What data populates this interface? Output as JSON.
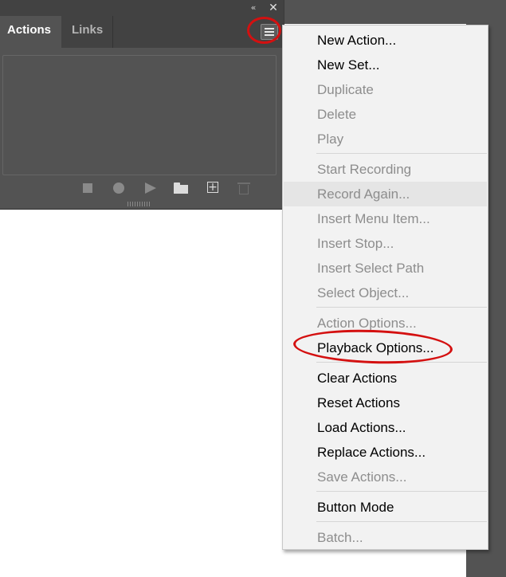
{
  "panel": {
    "collapse_glyph": "«",
    "close_glyph": "✕",
    "tabs": [
      {
        "label": "Actions",
        "active": true
      },
      {
        "label": "Links",
        "active": false
      }
    ],
    "toolbar_icons": [
      "stop-icon",
      "record-icon",
      "play-icon",
      "folder-icon",
      "new-action-icon",
      "trash-icon"
    ]
  },
  "menu": {
    "items": [
      {
        "label": "New Action...",
        "enabled": true
      },
      {
        "label": "New Set...",
        "enabled": true
      },
      {
        "label": "Duplicate",
        "enabled": false
      },
      {
        "label": "Delete",
        "enabled": false
      },
      {
        "label": "Play",
        "enabled": false
      },
      {
        "label": "Start Recording",
        "enabled": false
      },
      {
        "label": "Record Again...",
        "enabled": false,
        "highlighted": true
      },
      {
        "label": "Insert Menu Item...",
        "enabled": false
      },
      {
        "label": "Insert Stop...",
        "enabled": false
      },
      {
        "label": "Insert Select Path",
        "enabled": false
      },
      {
        "label": "Select Object...",
        "enabled": false
      },
      {
        "label": "Action Options...",
        "enabled": false
      },
      {
        "label": "Playback Options...",
        "enabled": true
      },
      {
        "label": "Clear Actions",
        "enabled": true
      },
      {
        "label": "Reset Actions",
        "enabled": true
      },
      {
        "label": "Load Actions...",
        "enabled": true
      },
      {
        "label": "Replace Actions...",
        "enabled": true
      },
      {
        "label": "Save Actions...",
        "enabled": false
      },
      {
        "label": "Button Mode",
        "enabled": true
      },
      {
        "label": "Batch...",
        "enabled": false
      }
    ]
  },
  "colors": {
    "panel_bg": "#535353",
    "tabbar_bg": "#424242",
    "menu_bg": "#f2f2f2",
    "disabled_text": "#8d8d8d",
    "annotation_red": "#d41010"
  }
}
